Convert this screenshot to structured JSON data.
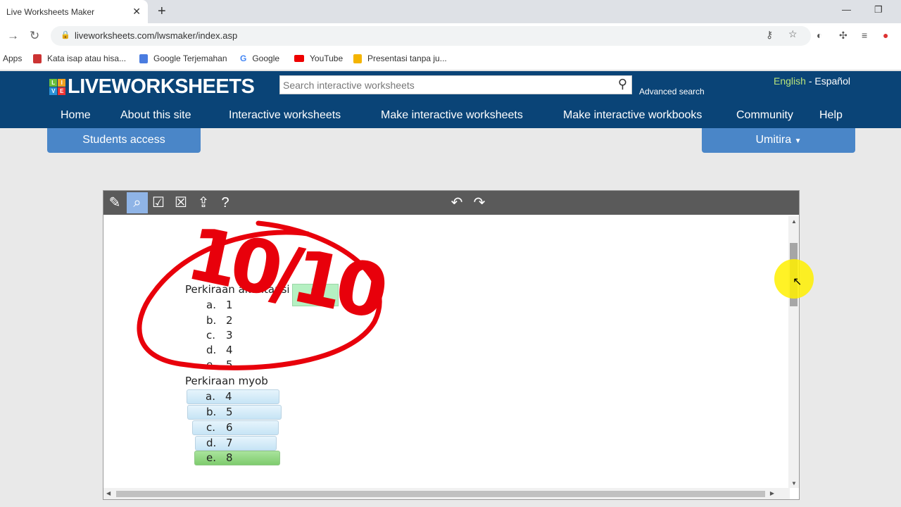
{
  "browser": {
    "tab_title": "Live Worksheets Maker",
    "url": "liveworksheets.com/lwsmaker/index.asp",
    "bookmarks": [
      "Apps",
      "Kata isap atau hisa...",
      "Google Terjemahan",
      "Google",
      "YouTube",
      "Presentasi tanpa ju..."
    ]
  },
  "site": {
    "logo": "LIVEWORKSHEETS",
    "logo_badge": [
      "L",
      "I",
      "V",
      "E"
    ],
    "search_placeholder": "Search interactive worksheets",
    "advanced_search": "Advanced search",
    "lang_english": "English",
    "lang_sep": "-",
    "lang_spanish": "Español",
    "menu": [
      "Home",
      "About this site",
      "Interactive worksheets",
      "Make interactive worksheets",
      "Make interactive workbooks",
      "Community",
      "Help"
    ],
    "students_access": "Students access",
    "user": "Umitira"
  },
  "editor": {
    "help": "?",
    "q1": {
      "text": "Perkiraan akuntansi",
      "answer": "e.",
      "options": [
        [
          "a.",
          "1"
        ],
        [
          "b.",
          "2"
        ],
        [
          "c.",
          "3"
        ],
        [
          "d.",
          "4"
        ],
        [
          "e.",
          "5"
        ]
      ]
    },
    "q2": {
      "text": "Perkiraan myob",
      "options": [
        [
          "a.",
          "4"
        ],
        [
          "b.",
          "5"
        ],
        [
          "c.",
          "6"
        ],
        [
          "d.",
          "7"
        ],
        [
          "e.",
          "8"
        ]
      ],
      "selected": "e."
    },
    "score_drawing": "10/10",
    "score_color": "#e8000b"
  },
  "colors": {
    "header": "#0a4477",
    "button": "#4a86c8"
  }
}
